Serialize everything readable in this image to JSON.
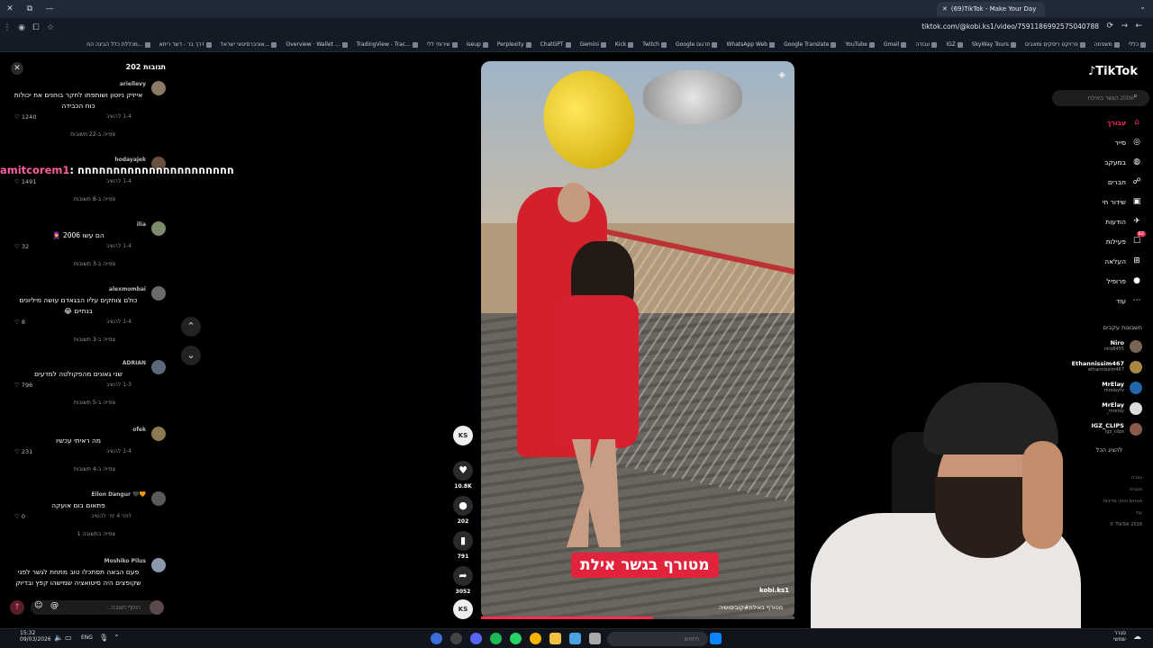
{
  "browser": {
    "tab_title": "(69)TikTok - Make Your Day",
    "url": "tiktok.com/@kobi.ks1/video/7591186992575040788",
    "bookmarks": [
      "כללי",
      "משפחה",
      "פרויקט ריסקים ומאבים",
      "SkyWay Tours",
      "IGZ",
      "עבודה",
      "Gmail",
      "YouTube",
      "Google Translate",
      "WhatsApp Web",
      "Google תרגום",
      "Twitch",
      "Kick",
      "Gemini",
      "ChatGPT",
      "Perplexity",
      "iseup",
      "שירותי ללי",
      "TradingView - Trac...",
      "Overview · Wallet ...",
      "אוניברסיטאי ישראל...",
      "דרך בר - דשד ריתא",
      "מכללת כלל הבינה הח..."
    ]
  },
  "comments_panel": {
    "title": "תגובות 202",
    "overlay_text_pink": "amitcorem1",
    "overlay_text_rest": ": חחחחחחחחחחחחחחחחחחחחחח",
    "comments": [
      {
        "user": "ariellevy",
        "text": "אייזיק ניוטון ושותפתו לחקר בוחנים את יכולות כוח הכבידה",
        "meta": "1-4   להשיב",
        "likes": "1240",
        "replies": "צפייה ב-22 תשובות"
      },
      {
        "user": "hodayajek",
        "text": "",
        "meta": "1-4   להשיב",
        "likes": "1491",
        "replies": "צפייה ב-8 תשובות"
      },
      {
        "user": "ilia",
        "text": "הם עשו 2006 🧕",
        "meta": "1-4   להשיב",
        "likes": "32",
        "replies": "צפייה ב-3 תשובות"
      },
      {
        "user": "alexmombai",
        "text": "כולם צוחקים עליו הבגאדם עושה מיליונים בנתיים 😂",
        "meta": "1-4   להשיב",
        "likes": "8",
        "replies": "צפייה ב-3 תשובות"
      },
      {
        "user": "ADRIAN",
        "text": "שני גאונים מהפקולטה למדעים",
        "meta": "1-3   להשיב",
        "likes": "796",
        "replies": "צפייה ב-5 תשובות"
      },
      {
        "user": "ofek",
        "text": "מה ראיתי עכשיו",
        "meta": "1-4   להשיב",
        "likes": "231",
        "replies": "צפייה ב-4 תשובות"
      },
      {
        "user": "🧡🖤 Eilon Dangur",
        "text": "פתאום בום אועקה",
        "meta": "לפני 4 ימ׳   להשיב",
        "likes": "0",
        "replies": "צפייה בתשובה 1"
      },
      {
        "user": "Moshiko Pilus",
        "text": "פעם הבאה תסתכלו טוב מתחת לגשר לפני שקופצים היה סיטואציה שמישהו קפץ ובדיוק",
        "meta": "",
        "likes": "",
        "replies": ""
      }
    ],
    "input_placeholder": "הוסף תגובה..."
  },
  "video": {
    "caption": "מטורף בגשר אילת",
    "handle": "kobi.ks1",
    "description": "מטורף באילת#קוביסושיה",
    "progress": 0.55
  },
  "actions": {
    "likes": "10.8K",
    "comments": "202",
    "saves": "791",
    "shares": "3052"
  },
  "sidebar": {
    "logo": "TikTok",
    "search_placeholder": "2006 הגשר באילת",
    "nav": [
      {
        "label": "עבורך",
        "icon": "home-icon"
      },
      {
        "label": "סייר",
        "icon": "compass-icon"
      },
      {
        "label": "במעקב",
        "icon": "following-icon"
      },
      {
        "label": "חברים",
        "icon": "friends-icon"
      },
      {
        "label": "שידור חי",
        "icon": "live-icon"
      },
      {
        "label": "הודעות",
        "icon": "messages-icon"
      },
      {
        "label": "פעילות",
        "icon": "activity-icon",
        "badge": "62"
      },
      {
        "label": "העלאה",
        "icon": "upload-icon"
      },
      {
        "label": "פרופיל",
        "icon": "profile-icon"
      },
      {
        "label": "עוד",
        "icon": "more-icon"
      }
    ],
    "following_title": "חשבונות עקבים",
    "accounts": [
      {
        "name": "Niro",
        "handle": "niro8455"
      },
      {
        "name": "Ethannissim467",
        "handle": "ethannissim467"
      },
      {
        "name": "MrElay",
        "handle": "mrelaytv"
      },
      {
        "name": "MrElay",
        "handle": "_mrelay"
      },
      {
        "name": "IGZ_CLIPS",
        "handle": "igz_clips"
      }
    ],
    "see_all": "להציג הכל",
    "footer": [
      "חברה",
      "תוכנית",
      "מונחים וחוקי מדיניות",
      "עוד",
      "© TikTok 2026"
    ]
  },
  "taskbar": {
    "time": "15:32",
    "date": "09/03/2026",
    "lang": "ENG",
    "search_placeholder": "חיפוש",
    "weather_top": "סגרר",
    "weather_bottom": "שמשי"
  },
  "colors": {
    "accent": "#fe2c55",
    "caption_bg": "#e2233c"
  }
}
